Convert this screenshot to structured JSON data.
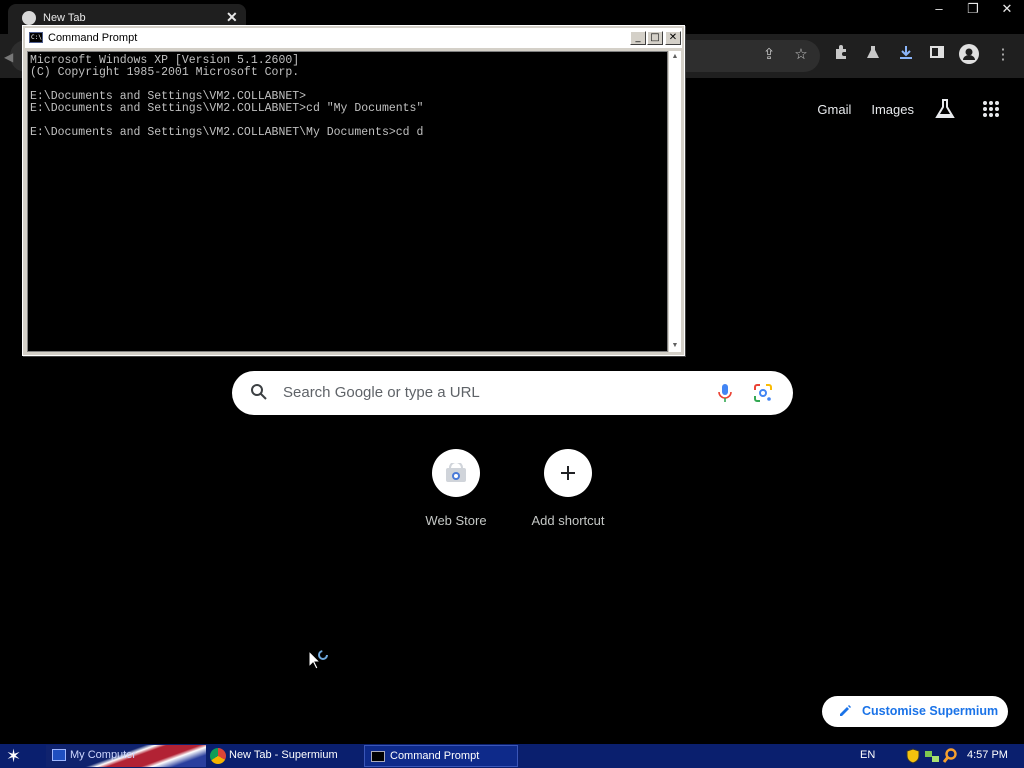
{
  "browser": {
    "tab_title": "New Tab",
    "window_controls": [
      "–",
      "❐",
      "✕"
    ]
  },
  "ntp": {
    "links": {
      "gmail": "Gmail",
      "images": "Images"
    },
    "search_placeholder": "Search Google or type a URL",
    "shortcuts": [
      {
        "label": "Web Store",
        "icon": "web-store-icon"
      },
      {
        "label": "Add shortcut",
        "icon": "plus-icon"
      }
    ],
    "customise_label": "Customise Supermium"
  },
  "cmd": {
    "title": "Command Prompt",
    "icon_text": "C:\\",
    "lines": [
      "Microsoft Windows XP [Version 5.1.2600]",
      "(C) Copyright 1985-2001 Microsoft Corp.",
      "",
      "E:\\Documents and Settings\\VM2.COLLABNET>",
      "E:\\Documents and Settings\\VM2.COLLABNET>cd \"My Documents\"",
      "",
      "E:\\Documents and Settings\\VM2.COLLABNET\\My Documents>cd d"
    ]
  },
  "taskbar": {
    "my_computer": "My Computer",
    "chrome_task": "New Tab - Supermium",
    "cmd_task": "Command Prompt",
    "language": "EN",
    "clock": "4:57 PM"
  },
  "colors": {
    "taskbar": "#0a1f6e",
    "accent_blue": "#1a73e8",
    "console_text": "#c0c0c0"
  }
}
